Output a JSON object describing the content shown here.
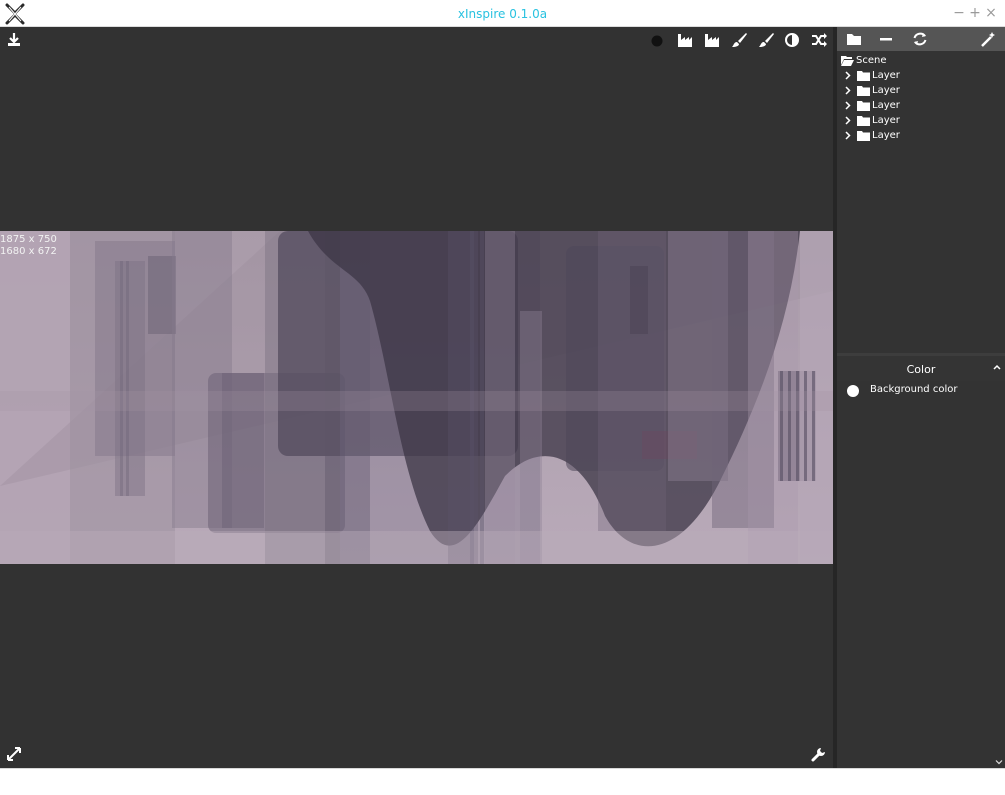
{
  "window": {
    "title": "xInspire 0.1.0a",
    "buttons": {
      "minimize": "−",
      "maximize": "+",
      "close": "×"
    },
    "accent_color": "#29c2e0"
  },
  "canvas": {
    "background": "#323232",
    "toolbar_icons": [
      "circle-fill-icon",
      "factory-icon",
      "factory-icon",
      "brush-icon",
      "brush-icon",
      "contrast-icon",
      "shuffle-icon"
    ],
    "download_icon": "download-icon",
    "expand_icon": "expand-icon",
    "wrench_icon": "wrench-icon",
    "preview": {
      "size_full": "1875 x 750",
      "size_display": "1680 x 672",
      "base_color": "#b7a7b6"
    }
  },
  "panel": {
    "toolbar_icons": [
      "folder-icon",
      "minus-icon",
      "refresh-icon",
      "magic-wand-icon"
    ],
    "tree": {
      "root": "Scene",
      "layers": [
        "Layer",
        "Layer",
        "Layer",
        "Layer",
        "Layer"
      ]
    },
    "color_section": {
      "title": "Color",
      "items": [
        {
          "label": "Background color",
          "swatch": "#ffffff"
        }
      ]
    }
  }
}
